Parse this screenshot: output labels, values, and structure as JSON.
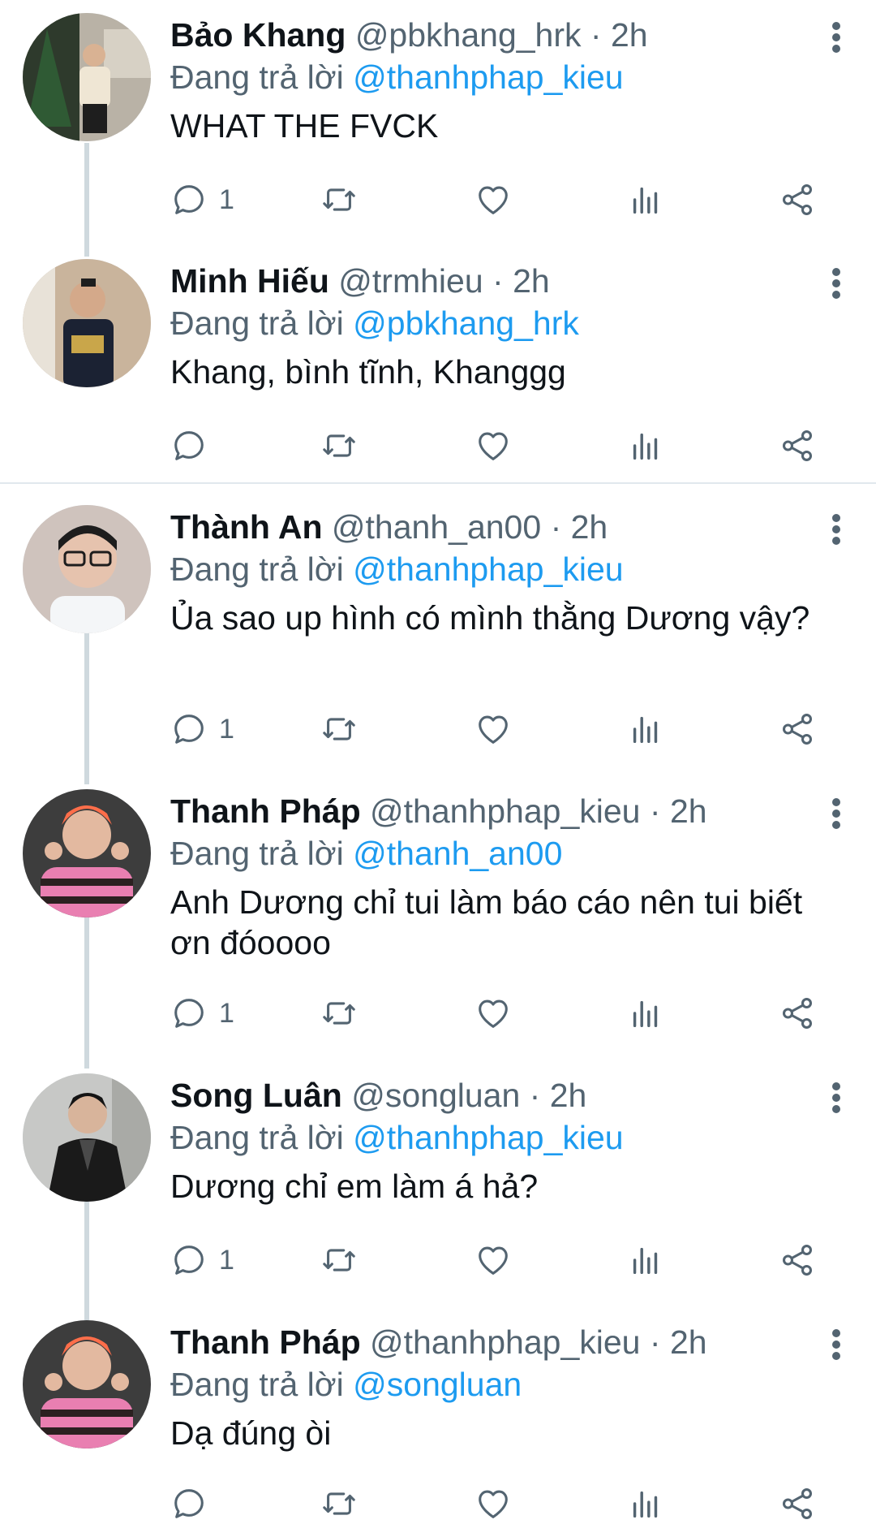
{
  "colors": {
    "text": "#0f1419",
    "secondary": "#536471",
    "mention": "#1d9bf0",
    "thread_line": "#cfd9de"
  },
  "icons": {
    "reply": "reply-bubble-icon",
    "retweet": "retweet-arrows-icon",
    "like": "heart-icon",
    "views": "bar-chart-icon",
    "share": "share-icon",
    "more": "vertical-dots-icon"
  },
  "tweets": [
    {
      "name": "Bảo Khang",
      "handle": "@pbkhang_hrk",
      "dot": "·",
      "time": "2h",
      "reply_prefix": "Đang trả lời",
      "reply_to": "@thanhphap_kieu",
      "text": "WHAT THE FVCK",
      "reply_count": "1"
    },
    {
      "name": "Minh Hiếu",
      "handle": "@trmhieu",
      "dot": "·",
      "time": "2h",
      "reply_prefix": "Đang trả lời",
      "reply_to": "@pbkhang_hrk",
      "text": "Khang, bình tĩnh, Khanggg",
      "reply_count": ""
    },
    {
      "name": "Thành An",
      "handle": "@thanh_an00",
      "dot": "·",
      "time": "2h",
      "reply_prefix": "Đang trả lời",
      "reply_to": "@thanhphap_kieu",
      "text": "Ủa sao up hình có mình thằng Dương vậy?",
      "reply_count": "1"
    },
    {
      "name": "Thanh Pháp",
      "handle": "@thanhphap_kieu",
      "dot": "·",
      "time": "2h",
      "reply_prefix": "Đang trả lời",
      "reply_to": "@thanh_an00",
      "text": "Anh Dương chỉ tui làm báo cáo nên tui biết ơn đóoooo",
      "reply_count": "1"
    },
    {
      "name": "Song Luân",
      "handle": "@songluan",
      "dot": "·",
      "time": "2h",
      "reply_prefix": "Đang trả lời",
      "reply_to": "@thanhphap_kieu",
      "text": "Dương chỉ em làm á hả?",
      "reply_count": "1"
    },
    {
      "name": "Thanh Pháp",
      "handle": "@thanhphap_kieu",
      "dot": "·",
      "time": "2h",
      "reply_prefix": "Đang trả lời",
      "reply_to": "@songluan",
      "text": "Dạ đúng òi",
      "reply_count": ""
    }
  ]
}
